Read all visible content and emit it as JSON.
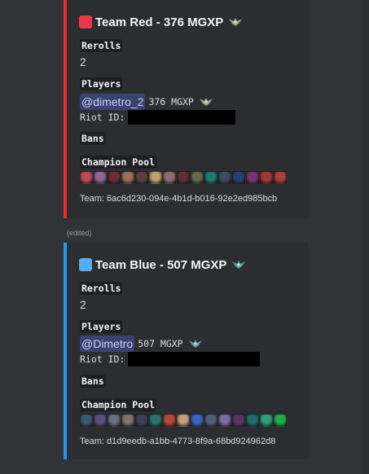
{
  "embeds": [
    {
      "id": "red",
      "title": "Team Red - 376 MGXP",
      "square_color": "#e8394a",
      "accent_color": "#ed2b2b",
      "rank_icon": "rank-emblem-icon",
      "rerolls_label": "Rerolls",
      "rerolls_value": "2",
      "players_label": "Players",
      "player_mention": "@dimetro_2",
      "player_mgxp": "376 MGXP",
      "riot_id_label": "Riot ID:",
      "bans_label": "Bans",
      "champion_pool_label": "Champion Pool",
      "champion_pool_icons": [
        "#c2485b",
        "#8d6a8e",
        "#6d2f33",
        "#9b6e5a",
        "#5d3f3a",
        "#bda06e",
        "#8f6c6f",
        "#5b2f35",
        "#63694c",
        "#1e7a6d",
        "#3c4a64",
        "#28406c",
        "#78346a",
        "#9d3a33",
        "#a74040"
      ],
      "team_id": "Team: 6ac6d230-094e-4b1d-b016-92e2ed985bcb"
    },
    {
      "id": "blue",
      "title": "Team Blue - 507 MGXP",
      "square_color": "#55acee",
      "accent_color": "#1d9bf0",
      "rank_icon": "rank-emblem-icon",
      "rerolls_label": "Rerolls",
      "rerolls_value": "2",
      "players_label": "Players",
      "player_mention": "@Dimetro",
      "player_mgxp": "507 MGXP",
      "riot_id_label": "Riot ID:",
      "bans_label": "Bans",
      "champion_pool_label": "Champion Pool",
      "champion_pool_icons": [
        "#3b5a70",
        "#5a5080",
        "#6a6f83",
        "#80746a",
        "#3d3f5b",
        "#2c6f72",
        "#b24a3a",
        "#c0a27a",
        "#3a64c0",
        "#4f5f7a",
        "#7e6aa0",
        "#5c3464",
        "#1f6e6a",
        "#2ea07a",
        "#1fae45"
      ],
      "team_id": "Team: d1d9eedb-a1bb-4773-8f9a-68bd924962d8"
    }
  ],
  "edited_label": "(edited)"
}
